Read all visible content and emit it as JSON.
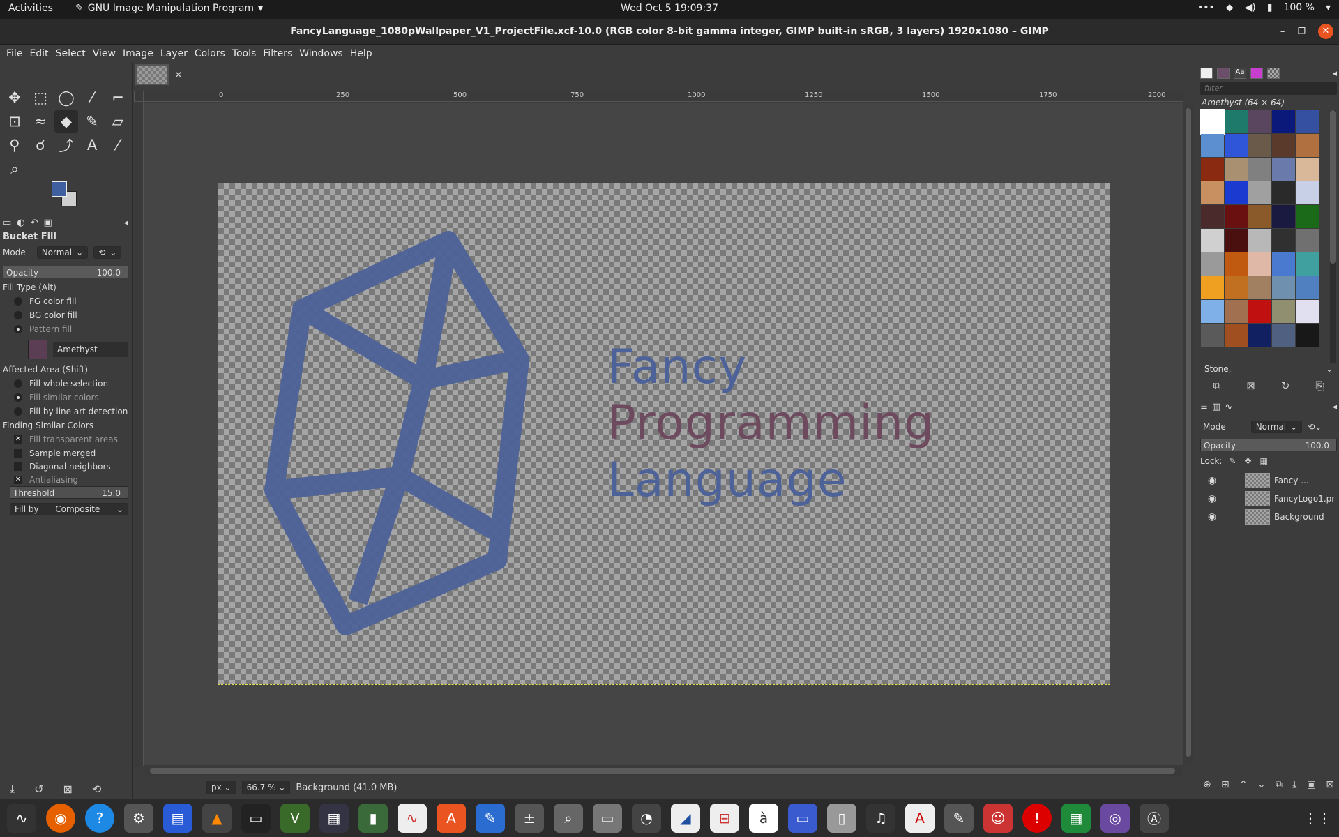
{
  "topbar": {
    "activities": "Activities",
    "app_name": "GNU Image Manipulation Program",
    "clock": "Wed Oct 5  19:09:37",
    "battery": "100 %"
  },
  "window": {
    "title": "FancyLanguage_1080pWallpaper_V1_ProjectFile.xcf-10.0 (RGB color 8-bit gamma integer, GIMP built-in sRGB, 3 layers) 1920x1080 – GIMP"
  },
  "menu": [
    "File",
    "Edit",
    "Select",
    "View",
    "Image",
    "Layer",
    "Colors",
    "Tools",
    "Filters",
    "Windows",
    "Help"
  ],
  "tool_options": {
    "title": "Bucket Fill",
    "mode_label": "Mode",
    "mode_value": "Normal",
    "opacity_label": "Opacity",
    "opacity_value": "100.0",
    "fill_type_label": "Fill Type  (Alt)",
    "fill_types": [
      "FG color fill",
      "BG color fill",
      "Pattern fill"
    ],
    "pattern_name": "Amethyst",
    "affected_area_label": "Affected Area  (Shift)",
    "affected_areas": [
      "Fill whole selection",
      "Fill similar colors",
      "Fill by line art detection"
    ],
    "finding_label": "Finding Similar Colors",
    "finding_options": [
      "Fill transparent areas",
      "Sample merged",
      "Diagonal neighbors",
      "Antialiasing"
    ],
    "threshold_label": "Threshold",
    "threshold_value": "15.0",
    "fillby_label": "Fill by",
    "fillby_value": "Composite"
  },
  "ruler": {
    "ticks": [
      "0",
      "250",
      "500",
      "750",
      "1000",
      "1250",
      "1500",
      "1750",
      "2000"
    ]
  },
  "canvas": {
    "text_line1": "Fancy",
    "text_line2": "Programming",
    "text_line3": "Language",
    "logo_color": "#4d6299",
    "text_pattern_color": "#6e4a5e"
  },
  "status": {
    "unit": "px",
    "zoom": "66.7 %",
    "info": "Background (41.0 MB)"
  },
  "patterns": {
    "filter_placeholder": "filter",
    "title": "Amethyst (64 × 64)",
    "selected_tag": "Stone,"
  },
  "layers": {
    "mode_label": "Mode",
    "mode_value": "Normal",
    "opacity_label": "Opacity",
    "opacity_value": "100.0",
    "lock_label": "Lock:",
    "items": [
      {
        "name": "Fancy ..."
      },
      {
        "name": "FancyLogo1.pr"
      },
      {
        "name": "Background"
      }
    ]
  }
}
